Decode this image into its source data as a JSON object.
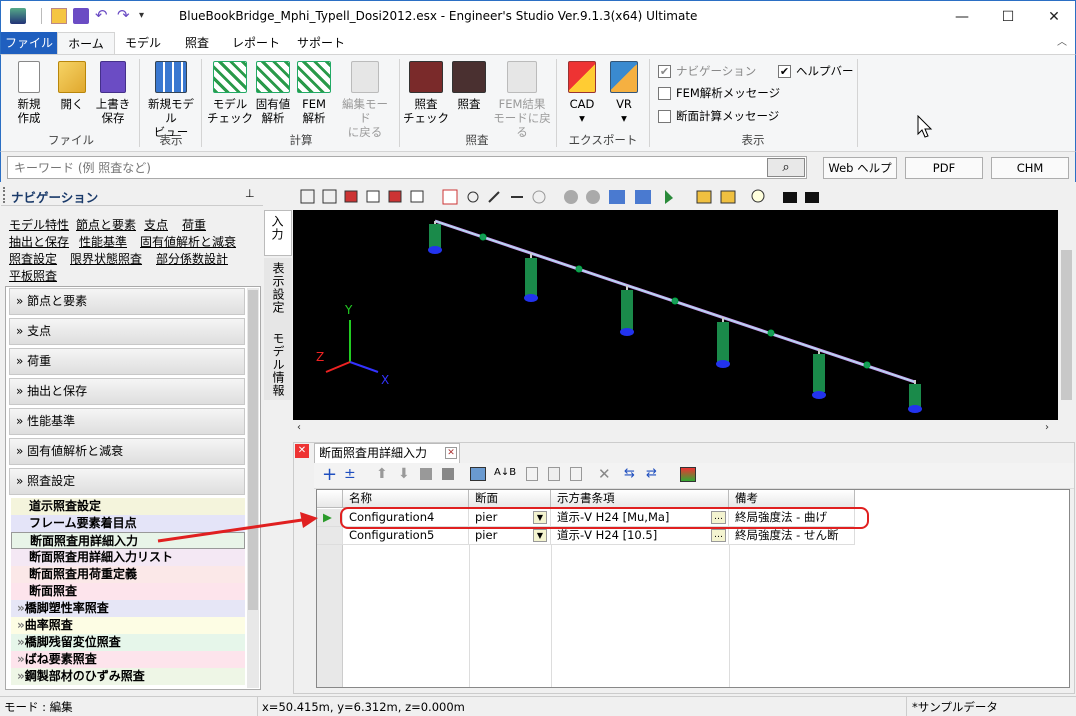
{
  "window": {
    "title": "BlueBookBridge_Mphi_Typell_Dosi2012.esx - Engineer's Studio Ver.9.1.3(x64) Ultimate"
  },
  "ribbon_tabs": [
    "ファイル",
    "ホーム",
    "モデル",
    "照査",
    "レポート",
    "サポート"
  ],
  "ribbon": {
    "buttons": [
      {
        "label1": "新規",
        "label2": "作成",
        "icon": "new-file-icon"
      },
      {
        "label1": "開く",
        "label2": "",
        "icon": "open-folder-icon"
      },
      {
        "label1": "上書き",
        "label2": "保存",
        "icon": "save-icon"
      },
      {
        "label1": "新規モデル",
        "label2": "ビュー",
        "icon": "model-view-icon"
      },
      {
        "label1": "モデル",
        "label2": "チェック",
        "icon": "model-check-icon"
      },
      {
        "label1": "固有値",
        "label2": "解析",
        "icon": "eigen-icon"
      },
      {
        "label1": "FEM",
        "label2": "解析",
        "icon": "fem-icon"
      },
      {
        "label1": "編集モード",
        "label2": "に戻る",
        "icon": "edit-mode-icon"
      },
      {
        "label1": "照査",
        "label2": "チェック",
        "icon": "verify-check-icon"
      },
      {
        "label1": "照査",
        "label2": "",
        "icon": "verify-icon"
      },
      {
        "label1": "FEM結果",
        "label2": "モードに戻る",
        "icon": "fem-result-icon"
      },
      {
        "label1": "CAD",
        "label2": "▾",
        "icon": "cad-icon"
      },
      {
        "label1": "VR",
        "label2": "▾",
        "icon": "vr-icon"
      }
    ],
    "groups": [
      "ファイル",
      "表示",
      "計算",
      "照査",
      "エクスポート",
      "表示"
    ],
    "checks": {
      "navigation": "ナビゲーション",
      "helpbar": "ヘルプバー",
      "fem_msg": "FEM解析メッセージ",
      "section_msg": "断面計算メッセージ"
    }
  },
  "search": {
    "placeholder": "キーワード (例 照査など)",
    "web_help": "Web ヘルプ",
    "pdf": "PDF",
    "chm": "CHM"
  },
  "nav": {
    "title": "ナビゲーション",
    "links": [
      "モデル特性",
      "節点と要素",
      "支点",
      "荷重",
      "抽出と保存",
      "性能基準",
      "固有値解析と減衰",
      "照査設定",
      "限界状態照査",
      "部分係数設計",
      "平板照査"
    ],
    "sections": [
      "節点と要素",
      "支点",
      "荷重",
      "抽出と保存",
      "性能基準",
      "固有値解析と減衰",
      "照査設定"
    ],
    "subitems": [
      "道示照査設定",
      "フレーム要素着目点",
      "断面照査用詳細入力",
      "断面照査用詳細入力リスト",
      "断面照査用荷重定義",
      "断面照査"
    ],
    "collapsed": [
      "橋脚塑性率照査",
      "曲率照査",
      "橋脚残留変位照査",
      "ばね要素照査",
      "鋼製部材のひずみ照査"
    ]
  },
  "side_tabs": [
    "入力",
    "表示設定",
    "モデル情報"
  ],
  "viewport": {
    "axis_x": "X",
    "axis_y": "Y",
    "axis_z": "Z"
  },
  "panel": {
    "tab_title": "断面照査用詳細入力",
    "columns": [
      "名称",
      "断面",
      "示方書条項",
      "備考"
    ],
    "rows": [
      {
        "name": "Configuration4",
        "section": "pier",
        "clause": "道示-V H24 [Mu,Ma]",
        "note": "終局強度法 - 曲げ"
      },
      {
        "name": "Configuration5",
        "section": "pier",
        "clause": "道示-V H24 [10.5]",
        "note": "終局強度法 - せん断"
      }
    ]
  },
  "status": {
    "mode": "モード : 編集",
    "coords": "x=50.415m, y=6.312m, z=0.000m",
    "sample": "*サンプルデータ"
  },
  "colors": {
    "accent": "#2b6fc4",
    "annotation": "#e02020"
  }
}
